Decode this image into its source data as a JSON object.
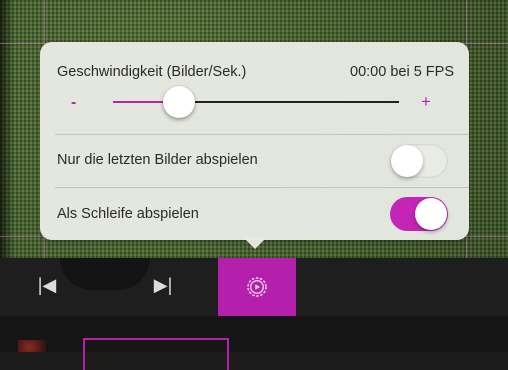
{
  "slider": {
    "label": "Geschwindigkeit (Bilder/Sek.)",
    "status": "00:00 bei 5 FPS",
    "minus_label": "-",
    "plus_label": "+",
    "value": 0.23
  },
  "options": [
    {
      "label": "Nur die letzten Bilder abspielen",
      "enabled": false
    },
    {
      "label": "Als Schleife abspielen",
      "enabled": true
    }
  ],
  "toolbar": {
    "prev_icon": "skip-to-start-icon",
    "next_icon": "skip-to-end-icon",
    "settings_icon": "gear-play-icon",
    "prev_glyph": "|◀",
    "next_glyph": "▶|"
  },
  "colors": {
    "accent": "#c020b0",
    "panel": "#e9ece5",
    "toolbar": "#1e1e1e"
  }
}
